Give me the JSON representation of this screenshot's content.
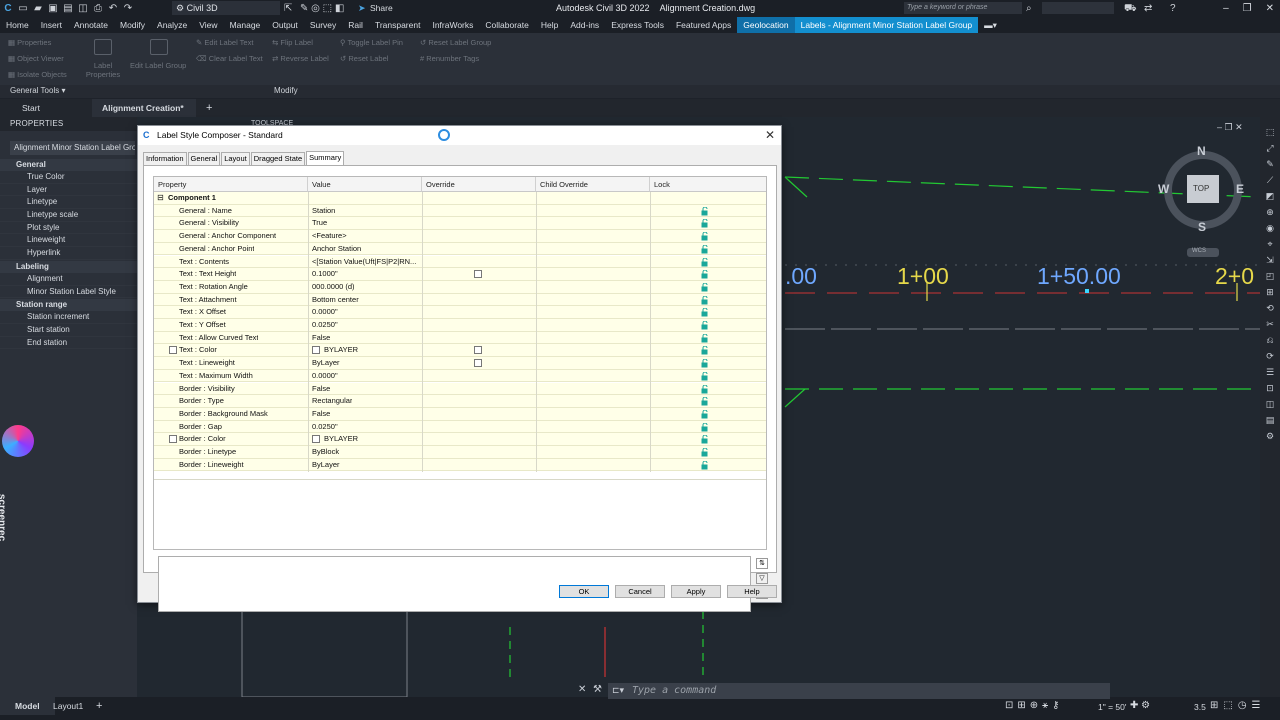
{
  "titlebar": {
    "workspace": "Civil 3D",
    "share": "Share",
    "app_title": "Autodesk Civil 3D 2022",
    "document": "Alignment Creation.dwg",
    "search_placeholder": "Type a keyword or phrase"
  },
  "ribbon_tabs": [
    "Home",
    "Insert",
    "Annotate",
    "Modify",
    "Analyze",
    "View",
    "Manage",
    "Output",
    "Survey",
    "Rail",
    "Transparent",
    "InfraWorks",
    "Collaborate",
    "Help",
    "Add-ins",
    "Express Tools",
    "Featured Apps",
    "Geolocation",
    "Labels - Alignment Minor Station Label Group"
  ],
  "ribbon": {
    "general_tools": [
      "Properties",
      "Object Viewer",
      "Isolate Objects"
    ],
    "large_buttons": [
      "Label Properties",
      "Edit Label Group"
    ],
    "modify_buttons": [
      "Edit Label Text",
      "Flip Label",
      "Toggle Label Pin",
      "Reset Label Group",
      "Clear Label Text",
      "Reverse Label",
      "Reset Label",
      "Renumber Tags"
    ],
    "panel_general": "General Tools",
    "panel_modify": "Modify"
  },
  "doc_tabs": [
    "Start",
    "Alignment Creation*"
  ],
  "properties": {
    "header": "PROPERTIES",
    "selection": "Alignment Minor Station Label Group",
    "categories": [
      {
        "name": "General",
        "rows": [
          "True Color",
          "Layer",
          "Linetype",
          "Linetype scale",
          "Plot style",
          "Lineweight",
          "Hyperlink"
        ]
      },
      {
        "name": "Labeling",
        "rows": [
          "Alignment",
          "Minor Station Label Style"
        ]
      },
      {
        "name": "Station range",
        "rows": [
          "Station increment",
          "Start station",
          "End station"
        ]
      }
    ]
  },
  "drawing": {
    "toolspace": "TOOLSPACE",
    "stations": [
      ".00",
      "1+00",
      "1+50.00",
      "2+0"
    ],
    "compass": {
      "n": "N",
      "s": "S",
      "e": "E",
      "w": "W",
      "top": "TOP",
      "wcs": "WCS"
    }
  },
  "bottom": {
    "model": "Model",
    "layout": "Layout1",
    "command_placeholder": "Type a command",
    "scale": "1\" = 50'",
    "version": "3.5"
  },
  "dialog": {
    "title": "Label Style Composer - Standard",
    "tabs": [
      "Information",
      "General",
      "Layout",
      "Dragged State",
      "Summary"
    ],
    "columns": [
      "Property",
      "Value",
      "Override",
      "Child Override",
      "Lock"
    ],
    "component": "Component 1",
    "rows": [
      {
        "property": "General : Name",
        "value": "Station",
        "override": false,
        "color_box": false
      },
      {
        "property": "General : Visibility",
        "value": "True",
        "override": false,
        "color_box": false
      },
      {
        "property": "General : Anchor Component",
        "value": "<Feature>",
        "override": false,
        "color_box": false
      },
      {
        "property": "General : Anchor Point",
        "value": "Anchor Station",
        "override": false,
        "color_box": false
      },
      {
        "property": "Text : Contents",
        "value": "<[Station Value(Uft|FS|P2|RN...",
        "override": false,
        "color_box": false
      },
      {
        "property": "Text : Text Height",
        "value": "0.1000\"",
        "override": true,
        "color_box": false
      },
      {
        "property": "Text : Rotation Angle",
        "value": "000.0000 (d)",
        "override": false,
        "color_box": false
      },
      {
        "property": "Text : Attachment",
        "value": "Bottom center",
        "override": false,
        "color_box": false
      },
      {
        "property": "Text : X Offset",
        "value": "0.0000\"",
        "override": false,
        "color_box": false
      },
      {
        "property": "Text : Y Offset",
        "value": "0.0250\"",
        "override": false,
        "color_box": false
      },
      {
        "property": "Text : Allow Curved Text",
        "value": "False",
        "override": false,
        "color_box": false
      },
      {
        "property": "Text : Color",
        "value": "BYLAYER",
        "override": true,
        "color_box": true
      },
      {
        "property": "Text : Lineweight",
        "value": "ByLayer",
        "override": true,
        "color_box": false
      },
      {
        "property": "Text : Maximum Width",
        "value": "0.0000\"",
        "override": false,
        "color_box": false
      },
      {
        "property": "Border : Visibility",
        "value": "False",
        "override": false,
        "color_box": false
      },
      {
        "property": "Border : Type",
        "value": "Rectangular",
        "override": false,
        "color_box": false
      },
      {
        "property": "Border : Background Mask",
        "value": "False",
        "override": false,
        "color_box": false
      },
      {
        "property": "Border : Gap",
        "value": "0.0250\"",
        "override": false,
        "color_box": false
      },
      {
        "property": "Border : Color",
        "value": "BYLAYER",
        "override": false,
        "color_box": true
      },
      {
        "property": "Border : Linetype",
        "value": "ByBlock",
        "override": false,
        "color_box": false
      },
      {
        "property": "Border : Lineweight",
        "value": "ByLayer",
        "override": false,
        "color_box": false
      }
    ],
    "buttons": {
      "ok": "OK",
      "cancel": "Cancel",
      "apply": "Apply",
      "help": "Help"
    }
  },
  "watermark": "screenrec",
  "colors": {
    "accent": "#0f6fa8",
    "ctx_tab": "#138fcf",
    "station_text": "#6fa8ff",
    "green_line": "#22c933",
    "lock": "#1aa79a"
  }
}
